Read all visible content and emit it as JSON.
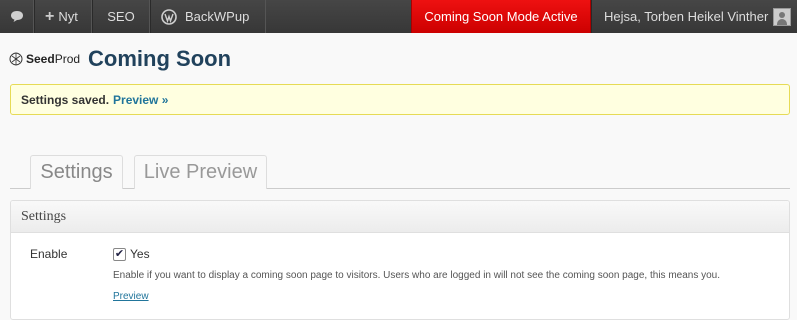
{
  "adminbar": {
    "new_label": "Nyt",
    "seo_label": "SEO",
    "backwpup_label": "BackWPup",
    "coming_soon_label": "Coming Soon Mode Active",
    "greeting": "Hejsa, Torben Heikel Vinther",
    "coming_soon_color": "#dd0000"
  },
  "header": {
    "logo_bold": "Seed",
    "logo_rest": "Prod",
    "title": "Coming Soon"
  },
  "notice": {
    "message": "Settings saved.",
    "link": "Preview »"
  },
  "tabs": [
    {
      "label": "Settings"
    },
    {
      "label": "Live Preview"
    }
  ],
  "panel": {
    "title": "Settings",
    "enable_label": "Enable",
    "checkbox_label": "Yes",
    "checked": true,
    "description": "Enable if you want to display a coming soon page to visitors. Users who are logged in will not see the coming soon page, this means you.",
    "preview_link": "Preview"
  }
}
